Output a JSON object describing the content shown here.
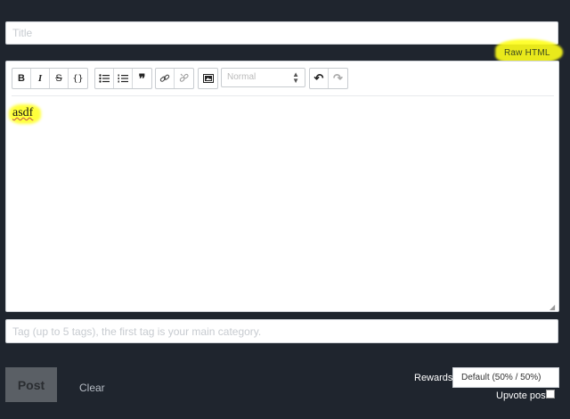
{
  "form": {
    "title_placeholder": "Title",
    "raw_html_label": "Raw HTML",
    "editor": {
      "content": "asdf",
      "format_placeholder": "Normal"
    },
    "tags_placeholder": "Tag (up to 5 tags), the first tag is your main category.",
    "post_label": "Post",
    "clear_label": "Clear",
    "rewards_label": "Rewards",
    "rewards_value": "Default (50% / 50%)",
    "upvote_label": "Upvote post",
    "upvote_checked": false
  },
  "toolbar": {
    "groups": [
      [
        "bold-icon",
        "italic-icon",
        "strikethrough-icon",
        "code-braces-icon"
      ],
      [
        "bullet-list-icon",
        "numbered-list-icon",
        "quote-icon"
      ],
      [
        "link-icon",
        "unlink-icon"
      ],
      [
        "image-icon"
      ],
      [
        "undo-icon",
        "redo-icon"
      ]
    ]
  },
  "colors": {
    "background": "#1f252e",
    "highlight": "#ffff1a"
  }
}
